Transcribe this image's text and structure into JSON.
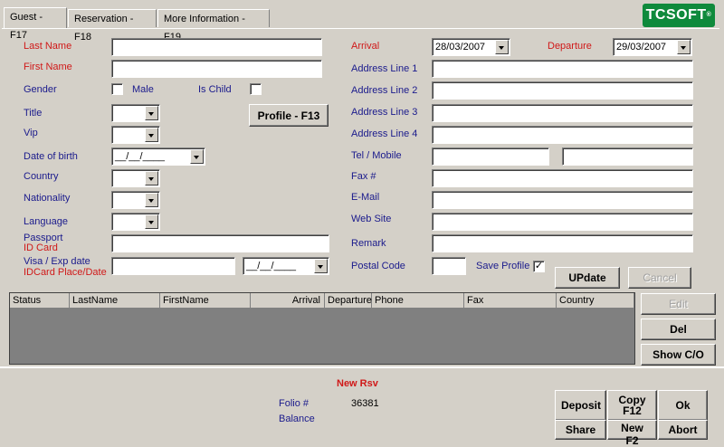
{
  "tabs": [
    "Guest - F17",
    "Reservation - F18",
    "More Information - F19"
  ],
  "logo": {
    "text": "TCSOFT",
    "mark": "®"
  },
  "guest": {
    "last_name_label": "Last Name",
    "first_name_label": "First Name",
    "gender_label": "Gender",
    "male_label": "Male",
    "is_child_label": "Is Child",
    "title_label": "Title",
    "vip_label": "Vip",
    "dob_label": "Date of birth",
    "dob_value": "__/__/____",
    "country_label": "Country",
    "nationality_label": "Nationality",
    "language_label": "Language",
    "passport_label": "Passport",
    "id_card_label": "ID Card",
    "visa_label": "Visa / Exp date",
    "idcard_place_label": "IDCard Place/Date",
    "visa_date_value": "__/__/____",
    "profile_button": "Profile - F13"
  },
  "address": {
    "arrival_label": "Arrival",
    "arrival_value": "28/03/2007",
    "departure_label": "Departure",
    "departure_value": "29/03/2007",
    "line1_label": "Address Line 1",
    "line2_label": "Address Line 2",
    "line3_label": "Address Line 3",
    "line4_label": "Address Line 4",
    "tel_label": "Tel / Mobile",
    "fax_label": "Fax #",
    "email_label": "E-Mail",
    "web_label": "Web Site",
    "remark_label": "Remark",
    "postal_label": "Postal Code",
    "save_profile_label": "Save Profile",
    "save_profile_check": "✓",
    "update_button": "UPdate",
    "cancel_button": "Cancel"
  },
  "grid": {
    "columns": [
      "Status",
      "LastName",
      "FirstName",
      "Arrival",
      "Departure",
      "Phone",
      "Fax",
      "Country"
    ]
  },
  "side_buttons": {
    "edit": "Edit",
    "del": "Del",
    "show": "Show C/O"
  },
  "bottom": {
    "new_rsv": "New Rsv",
    "folio_label": "Folio #",
    "folio_value": "36381",
    "balance_label": "Balance",
    "deposit": "Deposit",
    "copy": "Copy",
    "copy_key": "F12",
    "ok": "Ok",
    "share": "Share",
    "new_f2": "New F2",
    "abort": "Abort"
  }
}
